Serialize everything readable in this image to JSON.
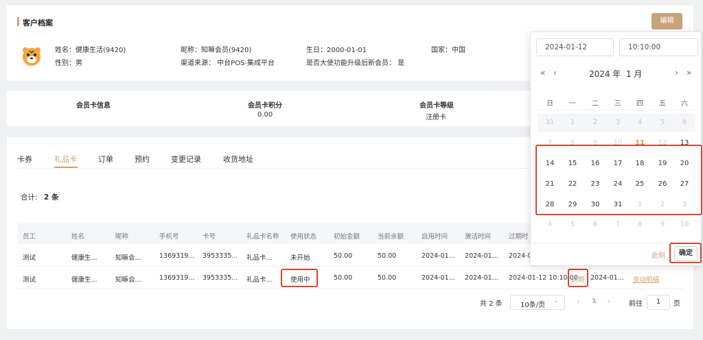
{
  "profile": {
    "title": "客户档案",
    "edit_label": "编辑",
    "fields": {
      "name": "姓名：健康生活(9420)",
      "gender": "性别：男",
      "nickname": "昵称：知嘛会员(9420)",
      "channel": "渠道来源：  中台POS-集成平台",
      "birthday": "生日：2000-01-01",
      "ambassador": "是否大使功能升级后新会员：  是",
      "country": "国家：中国"
    }
  },
  "card_info": {
    "col1": "会员卡信息",
    "col2_title": "会员卡积分",
    "col2_value": "0.00",
    "col3_title": "会员卡等级",
    "col3_value": "注册卡"
  },
  "tabs": [
    "卡券",
    "礼品卡",
    "订单",
    "预约",
    "变更记录",
    "收货地址"
  ],
  "summary": {
    "label": "合计:",
    "count": "2 条"
  },
  "table": {
    "headers": [
      "员工",
      "姓名",
      "昵称",
      "手机号",
      "卡号",
      "礼品卡名称",
      "使用状态",
      "初始金额",
      "当前余额",
      "启用时间",
      "激活时间",
      "过期时"
    ],
    "rows": [
      [
        "测试",
        "健康生...",
        "知嘛会...",
        "1369319...",
        "3953335...",
        "礼品卡...",
        "未开始",
        "50.00",
        "50.00",
        "2024-01...",
        "2024-01...",
        "2024-01"
      ],
      [
        "测试",
        "健康生...",
        "知嘛会...",
        "1369319...",
        "3953335...",
        "礼品卡...",
        "使用中",
        "50.00",
        "50.00",
        "2024-01...",
        "2024-01...",
        "2024-01-12 10:10:00"
      ]
    ],
    "extend_label": "延期",
    "row2_extra_date": "2024-01...",
    "change_detail": "变动明细"
  },
  "pagination": {
    "total": "共 2 条",
    "page_size": "10条/页",
    "current": "1",
    "goto_label": "前往",
    "goto_value": "1",
    "page_suffix": "页"
  },
  "datepicker": {
    "date_value": "2024-01-12",
    "time_value": "10:10:00",
    "header": "2024 年  1 月",
    "weekdays": [
      "日",
      "一",
      "二",
      "三",
      "四",
      "五",
      "六"
    ],
    "weeks": [
      [
        "31",
        "1",
        "2",
        "3",
        "4",
        "5",
        "6"
      ],
      [
        "7",
        "8",
        "9",
        "10",
        "11",
        "12",
        "13"
      ],
      [
        "14",
        "15",
        "16",
        "17",
        "18",
        "19",
        "20"
      ],
      [
        "21",
        "22",
        "23",
        "24",
        "25",
        "26",
        "27"
      ],
      [
        "28",
        "29",
        "30",
        "31",
        "1",
        "2",
        "3"
      ],
      [
        "4",
        "5",
        "6",
        "7",
        "8",
        "9",
        "10"
      ]
    ],
    "now_label": "此刻",
    "confirm_label": "确定"
  },
  "colors": {
    "accent": "#c9a37a",
    "highlight": "#d9452e",
    "today": "#e8913a"
  }
}
